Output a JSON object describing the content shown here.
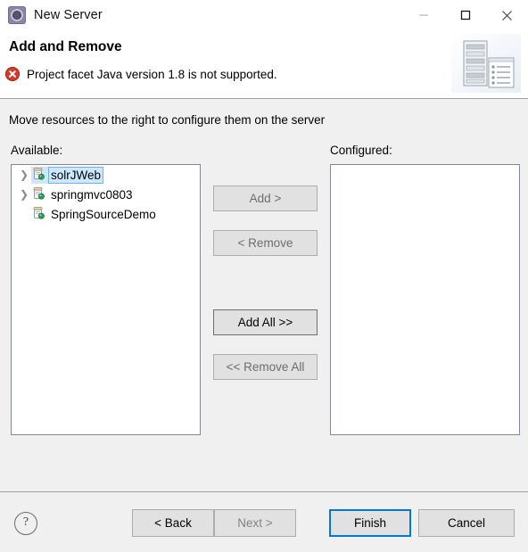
{
  "window": {
    "title": "New Server",
    "icon": "server-wizard-icon",
    "controls": {
      "minimize": "minimize-icon",
      "maximize": "maximize-icon",
      "close": "close-icon"
    }
  },
  "header": {
    "title": "Add and Remove",
    "status_icon": "error-icon",
    "status_message": "Project facet Java version 1.8 is not supported.",
    "banner_icon": "server-rack-icon"
  },
  "main": {
    "instruction": "Move resources to the right to configure them on the server",
    "available": {
      "label": "Available:",
      "items": [
        {
          "label": "solrJWeb",
          "expandable": true,
          "selected": true,
          "icon": "project-jar-icon"
        },
        {
          "label": "springmvc0803",
          "expandable": true,
          "selected": false,
          "icon": "project-jar-icon"
        },
        {
          "label": "SpringSourceDemo",
          "expandable": false,
          "selected": false,
          "icon": "project-jar-icon"
        }
      ]
    },
    "configured": {
      "label": "Configured:",
      "items": []
    },
    "transfer_buttons": [
      {
        "label": "Add >",
        "enabled": false
      },
      {
        "label": "< Remove",
        "enabled": false
      },
      {
        "label": "Add All >>",
        "enabled": true
      },
      {
        "label": "<< Remove All",
        "enabled": false
      }
    ]
  },
  "footer": {
    "help_icon": "help-question-icon",
    "buttons": {
      "back": "< Back",
      "next": "Next >",
      "finish": "Finish",
      "cancel": "Cancel"
    }
  },
  "colors": {
    "accent": "#0078d7",
    "error": "#d63b2a",
    "selection": "#cce8ff",
    "dialog_bg": "#f0f0f0"
  }
}
